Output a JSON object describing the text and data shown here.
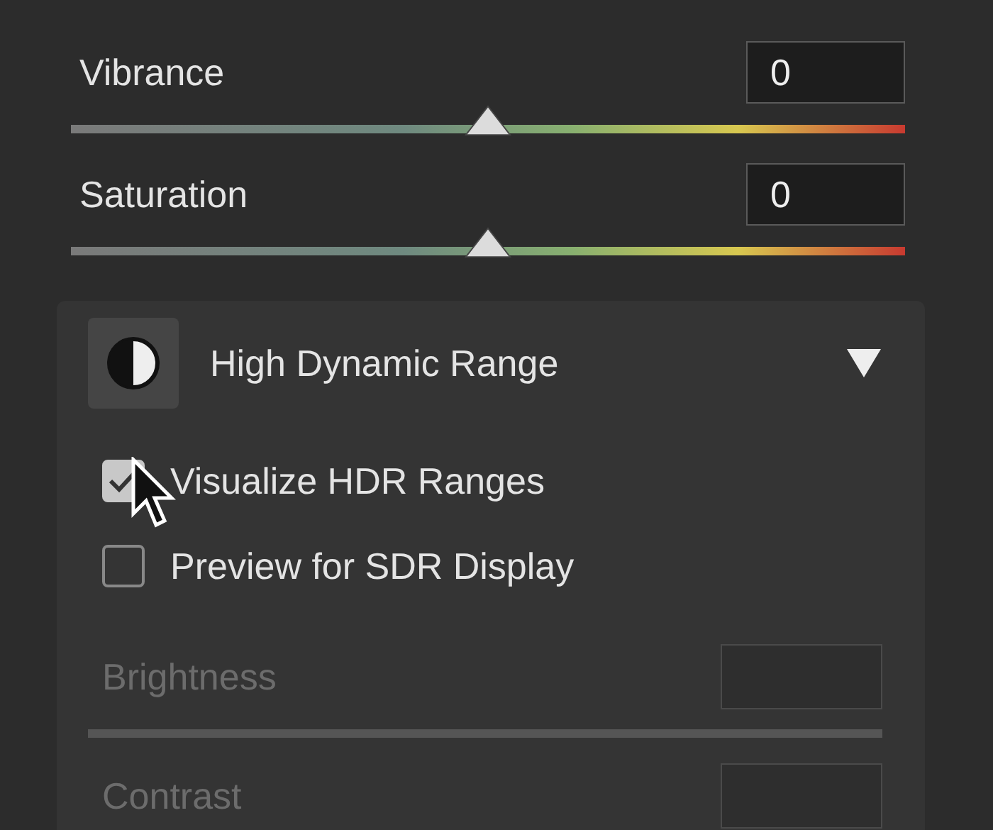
{
  "sliders": [
    {
      "label": "Vibrance",
      "value": "0",
      "level": 0.5
    },
    {
      "label": "Saturation",
      "value": "0",
      "level": 0.5
    }
  ],
  "section": {
    "title": "High Dynamic Range",
    "expanded": true,
    "checkboxes": [
      {
        "label": "Visualize HDR Ranges",
        "checked": true
      },
      {
        "label": "Preview for SDR Display",
        "checked": false
      }
    ],
    "sliders": [
      {
        "label": "Brightness",
        "disabled": true
      },
      {
        "label": "Contrast",
        "disabled": true
      }
    ]
  }
}
